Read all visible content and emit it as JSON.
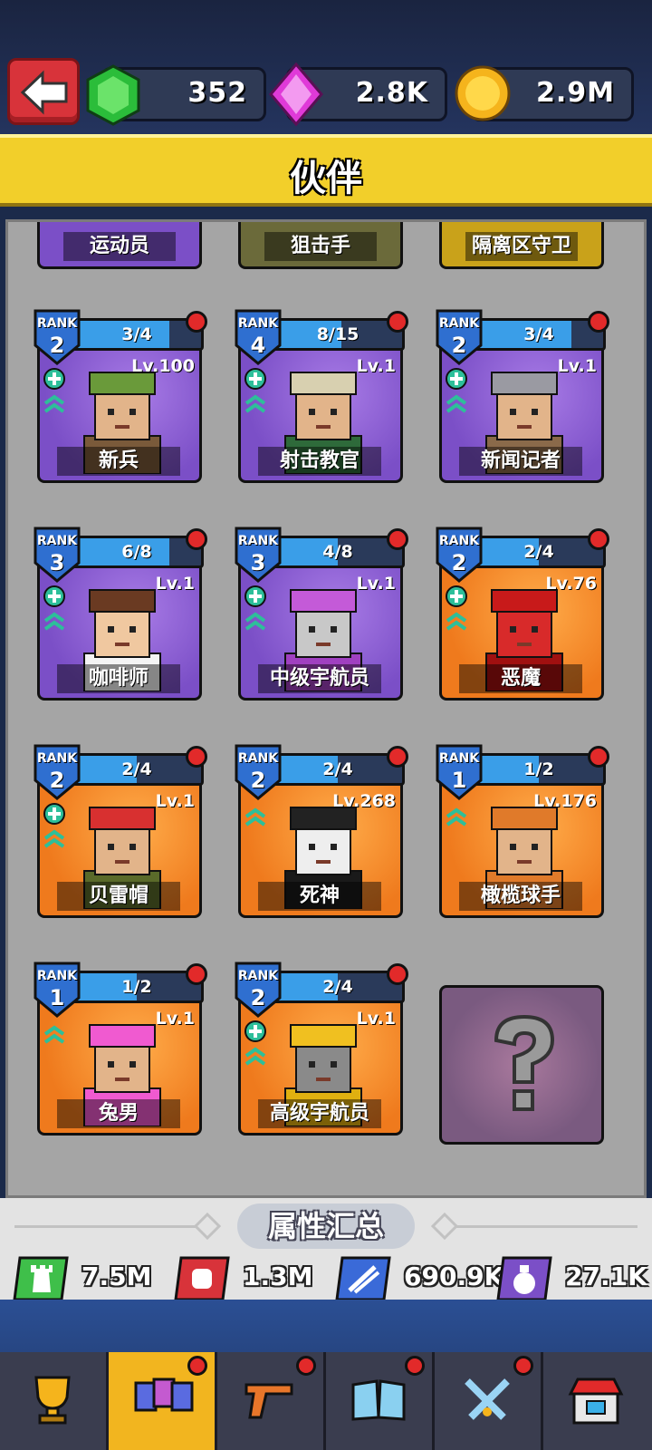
{
  "header": {
    "gems": "352",
    "diamonds": "2.8K",
    "coins": "2.9M",
    "title": "伙伴"
  },
  "partial_row": [
    {
      "name": "运动员"
    },
    {
      "name": "狙击手"
    },
    {
      "name": "隔离区守卫"
    }
  ],
  "partners": [
    {
      "name": "新兵",
      "rank": "2",
      "progress": "3/4",
      "progress_ratio": 0.75,
      "level": "Lv.100",
      "theme": "purple",
      "upgradable": true,
      "char": "soldier"
    },
    {
      "name": "射击教官",
      "rank": "4",
      "progress": "8/15",
      "progress_ratio": 0.53,
      "level": "Lv.1",
      "theme": "purple",
      "upgradable": true,
      "char": "instructor"
    },
    {
      "name": "新闻记者",
      "rank": "2",
      "progress": "3/4",
      "progress_ratio": 0.75,
      "level": "Lv.1",
      "theme": "purple",
      "upgradable": true,
      "char": "reporter"
    },
    {
      "name": "咖啡师",
      "rank": "3",
      "progress": "6/8",
      "progress_ratio": 0.75,
      "level": "Lv.1",
      "theme": "purple",
      "upgradable": true,
      "char": "barista"
    },
    {
      "name": "中级宇航员",
      "rank": "3",
      "progress": "4/8",
      "progress_ratio": 0.5,
      "level": "Lv.1",
      "theme": "purple",
      "upgradable": true,
      "char": "astro_mid"
    },
    {
      "name": "恶魔",
      "rank": "2",
      "progress": "2/4",
      "progress_ratio": 0.5,
      "level": "Lv.76",
      "theme": "orange",
      "upgradable": true,
      "char": "demon"
    },
    {
      "name": "贝雷帽",
      "rank": "2",
      "progress": "2/4",
      "progress_ratio": 0.5,
      "level": "Lv.1",
      "theme": "orange",
      "upgradable": true,
      "char": "beret"
    },
    {
      "name": "死神",
      "rank": "2",
      "progress": "2/4",
      "progress_ratio": 0.5,
      "level": "Lv.268",
      "theme": "orange",
      "upgradable": false,
      "char": "reaper"
    },
    {
      "name": "橄榄球手",
      "rank": "1",
      "progress": "1/2",
      "progress_ratio": 0.5,
      "level": "Lv.176",
      "theme": "orange",
      "upgradable": false,
      "char": "rugby"
    },
    {
      "name": "兔男",
      "rank": "1",
      "progress": "1/2",
      "progress_ratio": 0.5,
      "level": "Lv.1",
      "theme": "orange",
      "upgradable": false,
      "char": "bunny"
    },
    {
      "name": "高级宇航员",
      "rank": "2",
      "progress": "2/4",
      "progress_ratio": 0.5,
      "level": "Lv.1",
      "theme": "orange",
      "upgradable": true,
      "char": "astro_high"
    }
  ],
  "rank_label": "RANK",
  "summary": {
    "title": "属性汇总",
    "stats": [
      {
        "icon": "tower-icon",
        "value": "7.5M",
        "color": "#3fbf4a"
      },
      {
        "icon": "fist-icon",
        "value": "1.3M",
        "color": "#d8333a"
      },
      {
        "icon": "ammo-icon",
        "value": "690.9K",
        "color": "#3a6ad8"
      },
      {
        "icon": "money-bag-icon",
        "value": "27.1K",
        "color": "#7b4fc7"
      }
    ]
  },
  "nav": [
    {
      "icon": "trophy-icon",
      "active": false,
      "badge": false
    },
    {
      "icon": "partner-cards-icon",
      "active": true,
      "badge": true
    },
    {
      "icon": "pistol-icon",
      "active": false,
      "badge": true
    },
    {
      "icon": "book-icon",
      "active": false,
      "badge": true
    },
    {
      "icon": "crossed-swords-icon",
      "active": false,
      "badge": true
    },
    {
      "icon": "shop-icon",
      "active": false,
      "badge": false
    }
  ]
}
